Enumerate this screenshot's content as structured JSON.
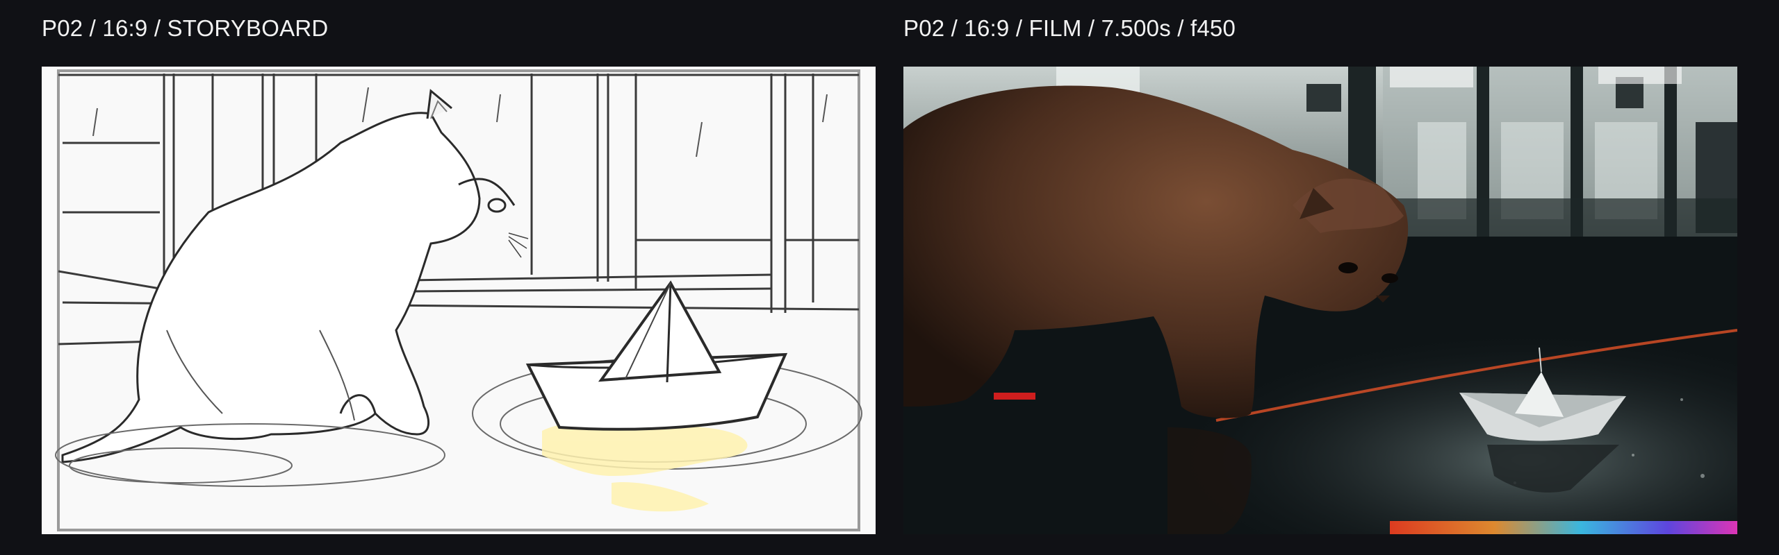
{
  "panels": [
    {
      "label": "P02 / 16:9 / STORYBOARD",
      "kind": "storyboard"
    },
    {
      "label": "P02 / 16:9 / FILM / 7.500s / f450",
      "kind": "film"
    }
  ],
  "colors": {
    "background": "#101115",
    "label_text": "#f2f2f2",
    "sketch_paper": "#f7f7f7",
    "sketch_line": "#2a2a2a",
    "puddle_highlight": "#fff2b0",
    "film_cat": "#5a3a28",
    "film_floor": "#0e1416"
  }
}
